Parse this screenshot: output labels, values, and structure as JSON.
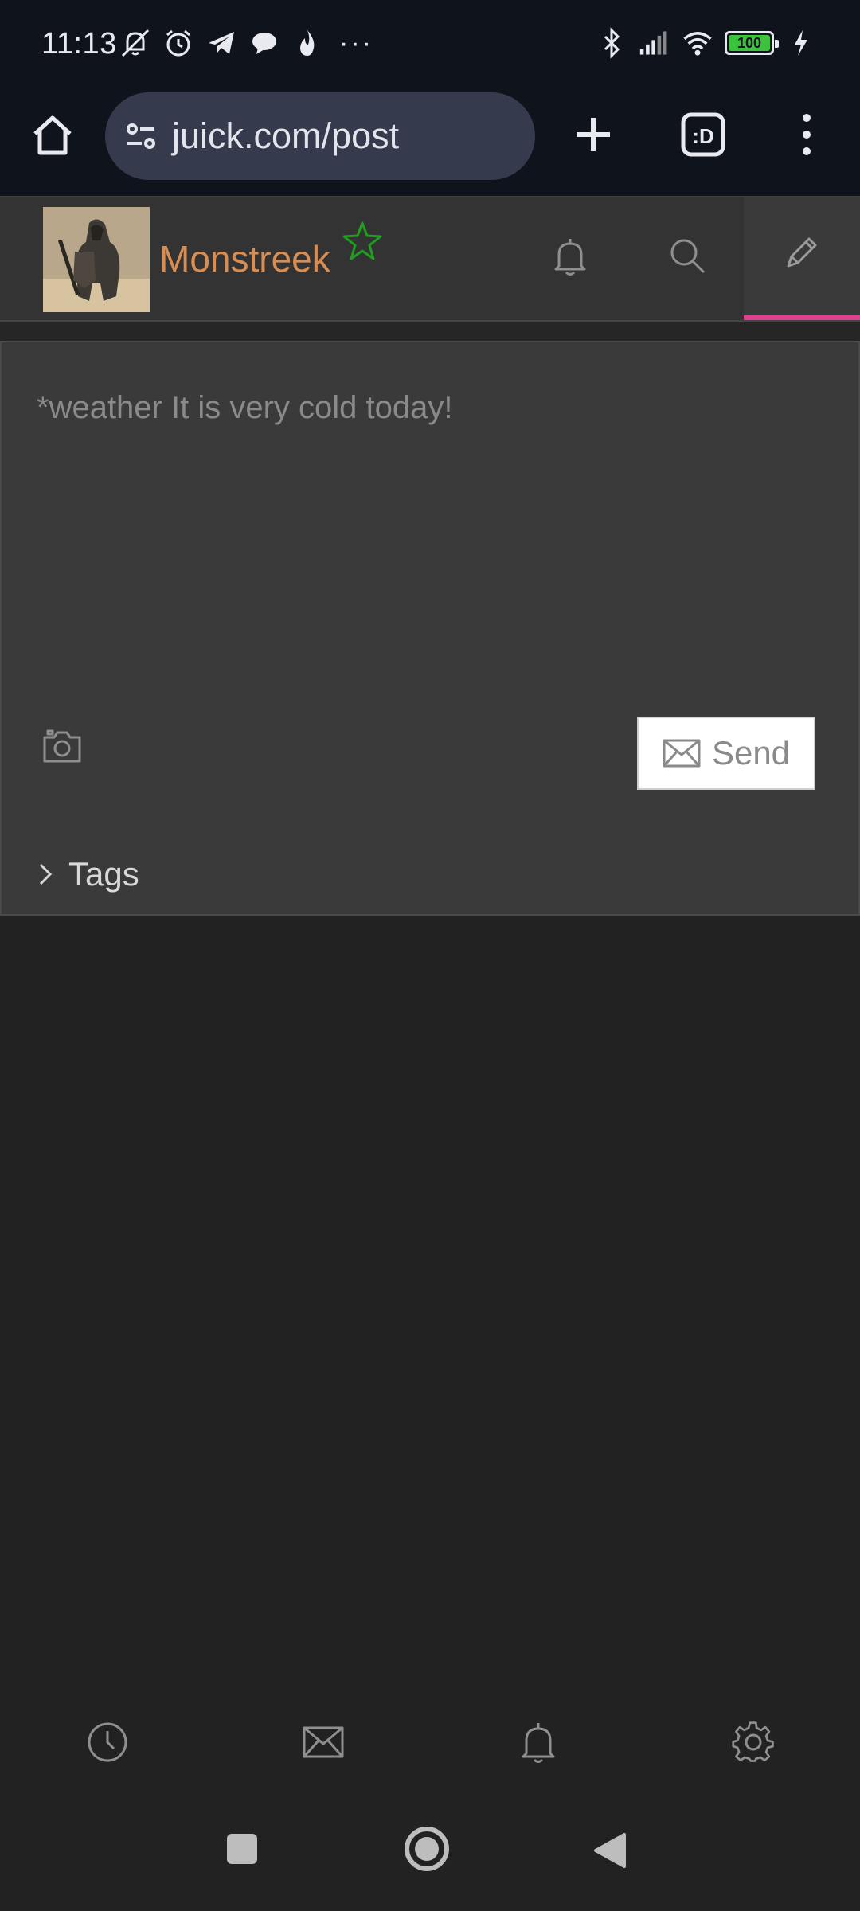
{
  "status_bar": {
    "time": "11:13",
    "battery_level": "100",
    "icons_left": [
      "mute-icon",
      "alarm-icon",
      "telegram-icon",
      "chat-bubble-icon",
      "flame-icon",
      "more-dots-icon"
    ],
    "icons_right": [
      "bluetooth-icon",
      "signal-icon",
      "wifi-icon",
      "battery-icon",
      "charging-icon"
    ],
    "more_indicator": "···"
  },
  "browser": {
    "url": "juick.com/post",
    "tab_switcher_label": ":D"
  },
  "header": {
    "username": "Monstreek",
    "colors": {
      "username": "#d88e53",
      "star": "#1f9e1f",
      "active_underline": "#e0408f"
    }
  },
  "composer": {
    "placeholder": "*weather It is very cold today!",
    "send_label": "Send",
    "tags_label": "Tags"
  },
  "bottom_nav": {
    "items": [
      "clock-icon",
      "mail-icon",
      "bell-icon",
      "settings-gear-icon"
    ]
  },
  "system_nav": {
    "items": [
      "recents-button",
      "home-button",
      "back-button"
    ]
  }
}
